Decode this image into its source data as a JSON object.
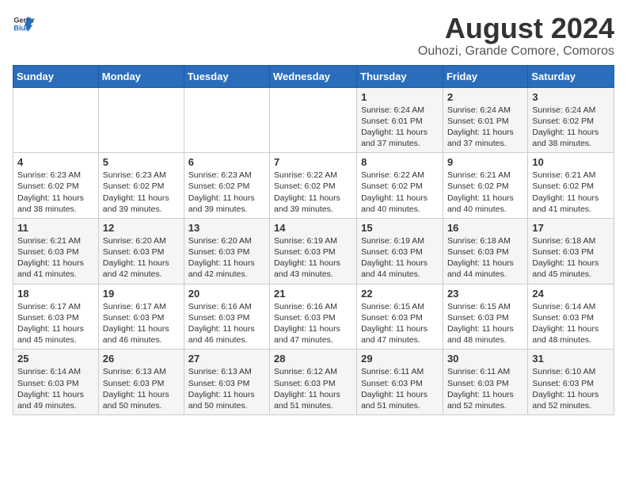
{
  "logo": {
    "line1": "General",
    "line2": "Blue"
  },
  "title": "August 2024",
  "location": "Ouhozi, Grande Comore, Comoros",
  "days_of_week": [
    "Sunday",
    "Monday",
    "Tuesday",
    "Wednesday",
    "Thursday",
    "Friday",
    "Saturday"
  ],
  "weeks": [
    [
      {
        "day": "",
        "info": ""
      },
      {
        "day": "",
        "info": ""
      },
      {
        "day": "",
        "info": ""
      },
      {
        "day": "",
        "info": ""
      },
      {
        "day": "1",
        "info": "Sunrise: 6:24 AM\nSunset: 6:01 PM\nDaylight: 11 hours\nand 37 minutes."
      },
      {
        "day": "2",
        "info": "Sunrise: 6:24 AM\nSunset: 6:01 PM\nDaylight: 11 hours\nand 37 minutes."
      },
      {
        "day": "3",
        "info": "Sunrise: 6:24 AM\nSunset: 6:02 PM\nDaylight: 11 hours\nand 38 minutes."
      }
    ],
    [
      {
        "day": "4",
        "info": "Sunrise: 6:23 AM\nSunset: 6:02 PM\nDaylight: 11 hours\nand 38 minutes."
      },
      {
        "day": "5",
        "info": "Sunrise: 6:23 AM\nSunset: 6:02 PM\nDaylight: 11 hours\nand 39 minutes."
      },
      {
        "day": "6",
        "info": "Sunrise: 6:23 AM\nSunset: 6:02 PM\nDaylight: 11 hours\nand 39 minutes."
      },
      {
        "day": "7",
        "info": "Sunrise: 6:22 AM\nSunset: 6:02 PM\nDaylight: 11 hours\nand 39 minutes."
      },
      {
        "day": "8",
        "info": "Sunrise: 6:22 AM\nSunset: 6:02 PM\nDaylight: 11 hours\nand 40 minutes."
      },
      {
        "day": "9",
        "info": "Sunrise: 6:21 AM\nSunset: 6:02 PM\nDaylight: 11 hours\nand 40 minutes."
      },
      {
        "day": "10",
        "info": "Sunrise: 6:21 AM\nSunset: 6:02 PM\nDaylight: 11 hours\nand 41 minutes."
      }
    ],
    [
      {
        "day": "11",
        "info": "Sunrise: 6:21 AM\nSunset: 6:03 PM\nDaylight: 11 hours\nand 41 minutes."
      },
      {
        "day": "12",
        "info": "Sunrise: 6:20 AM\nSunset: 6:03 PM\nDaylight: 11 hours\nand 42 minutes."
      },
      {
        "day": "13",
        "info": "Sunrise: 6:20 AM\nSunset: 6:03 PM\nDaylight: 11 hours\nand 42 minutes."
      },
      {
        "day": "14",
        "info": "Sunrise: 6:19 AM\nSunset: 6:03 PM\nDaylight: 11 hours\nand 43 minutes."
      },
      {
        "day": "15",
        "info": "Sunrise: 6:19 AM\nSunset: 6:03 PM\nDaylight: 11 hours\nand 44 minutes."
      },
      {
        "day": "16",
        "info": "Sunrise: 6:18 AM\nSunset: 6:03 PM\nDaylight: 11 hours\nand 44 minutes."
      },
      {
        "day": "17",
        "info": "Sunrise: 6:18 AM\nSunset: 6:03 PM\nDaylight: 11 hours\nand 45 minutes."
      }
    ],
    [
      {
        "day": "18",
        "info": "Sunrise: 6:17 AM\nSunset: 6:03 PM\nDaylight: 11 hours\nand 45 minutes."
      },
      {
        "day": "19",
        "info": "Sunrise: 6:17 AM\nSunset: 6:03 PM\nDaylight: 11 hours\nand 46 minutes."
      },
      {
        "day": "20",
        "info": "Sunrise: 6:16 AM\nSunset: 6:03 PM\nDaylight: 11 hours\nand 46 minutes."
      },
      {
        "day": "21",
        "info": "Sunrise: 6:16 AM\nSunset: 6:03 PM\nDaylight: 11 hours\nand 47 minutes."
      },
      {
        "day": "22",
        "info": "Sunrise: 6:15 AM\nSunset: 6:03 PM\nDaylight: 11 hours\nand 47 minutes."
      },
      {
        "day": "23",
        "info": "Sunrise: 6:15 AM\nSunset: 6:03 PM\nDaylight: 11 hours\nand 48 minutes."
      },
      {
        "day": "24",
        "info": "Sunrise: 6:14 AM\nSunset: 6:03 PM\nDaylight: 11 hours\nand 48 minutes."
      }
    ],
    [
      {
        "day": "25",
        "info": "Sunrise: 6:14 AM\nSunset: 6:03 PM\nDaylight: 11 hours\nand 49 minutes."
      },
      {
        "day": "26",
        "info": "Sunrise: 6:13 AM\nSunset: 6:03 PM\nDaylight: 11 hours\nand 50 minutes."
      },
      {
        "day": "27",
        "info": "Sunrise: 6:13 AM\nSunset: 6:03 PM\nDaylight: 11 hours\nand 50 minutes."
      },
      {
        "day": "28",
        "info": "Sunrise: 6:12 AM\nSunset: 6:03 PM\nDaylight: 11 hours\nand 51 minutes."
      },
      {
        "day": "29",
        "info": "Sunrise: 6:11 AM\nSunset: 6:03 PM\nDaylight: 11 hours\nand 51 minutes."
      },
      {
        "day": "30",
        "info": "Sunrise: 6:11 AM\nSunset: 6:03 PM\nDaylight: 11 hours\nand 52 minutes."
      },
      {
        "day": "31",
        "info": "Sunrise: 6:10 AM\nSunset: 6:03 PM\nDaylight: 11 hours\nand 52 minutes."
      }
    ]
  ]
}
